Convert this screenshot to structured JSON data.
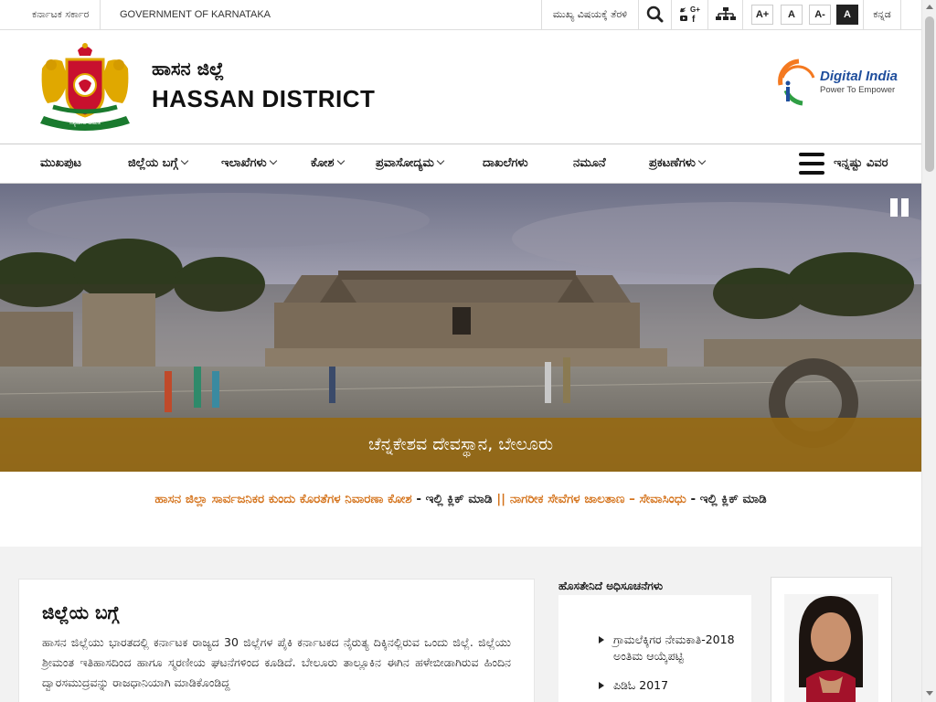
{
  "topbar": {
    "gov_kn": "ಕರ್ನಾಟಕ ಸರ್ಕಾರ",
    "gov_en": "GOVERNMENT OF KARNATAKA",
    "skip": "ಮುಖ್ಯ ವಿಷಯಕ್ಕೆ ತೆರಳಿ",
    "font_sizes": [
      "A+",
      "A",
      "A-",
      "A"
    ],
    "language": "ಕನ್ನಡ",
    "icons": [
      "search-icon",
      "social-icons",
      "sitemap-icon"
    ]
  },
  "header": {
    "title_kn": "ಹಾಸನ ಜಿಲ್ಲೆ",
    "title_en": "HASSAN DISTRICT",
    "emblem_text": "ಸತ್ಯಮೇವ ಜಯತೆ",
    "digital_india": {
      "title": "Digital India",
      "tagline": "Power To Empower"
    }
  },
  "nav": {
    "items": [
      {
        "label": "ಮುಖಪುಟ"
      },
      {
        "label": "ಜಿಲ್ಲೆಯ ಬಗ್ಗೆ"
      },
      {
        "label": "ಇಲಾಖೆಗಳು"
      },
      {
        "label": "ಕೋಶ"
      },
      {
        "label": "ಪ್ರವಾಸೋದ್ಯಮ"
      },
      {
        "label": "ದಾಖಲೆಗಳು"
      },
      {
        "label": "ನಮೂನೆ"
      },
      {
        "label": "ಪ್ರಕಟಣೆಗಳು"
      }
    ],
    "more": "ಇನ್ನಷ್ಟು ವಿವರ"
  },
  "hero": {
    "caption": "ಚೆನ್ನಕೇಶವ ದೇವಸ್ಥಾನ, ಬೇಲೂರು"
  },
  "infoline": {
    "link1": "ಹಾಸನ ಜಿಲ್ಲಾ ಸಾರ್ವಜನಿಕರ ಕುಂದು ಕೊರತೆಗಳ ನಿವಾರಣಾ ಕೋಶ",
    "click1": " - ಇಲ್ಲಿ ಕ್ಲಿಕ್ ಮಾಡಿ ",
    "sep": "||",
    "link2": " ನಾಗರೀಕ ಸೇವೆಗಳ ಜಾಲತಾಣ – ಸೇವಾಸಿಂಧು",
    "click2": " - ಇಲ್ಲಿ ಕ್ಲಿಕ್ ಮಾಡಿ"
  },
  "about": {
    "heading": "ಜಿಲ್ಲೆಯ ಬಗ್ಗೆ",
    "text": "ಹಾಸನ ಜಿಲ್ಲೆಯು ಭಾರತದಲ್ಲಿ ಕರ್ನಾಟಕ ರಾಜ್ಯದ 30 ಜಿಲ್ಲೆಗಳ ಪೈಕಿ ಕರ್ನಾಟಕದ ನೈರುತ್ಯ ದಿಕ್ಕಿನಲ್ಲಿರುವ ಒಂದು ಜಿಲ್ಲೆ. ಜಿಲ್ಲೆಯು ಶ್ರೀಮಂತ ಇತಿಹಾಸದಿಂದ ಹಾಗೂ ಸ್ಮರಣೀಯ ಘಟನೆಗಳಿಂದ ಕೂಡಿದೆ. ಬೇಲೂರು ತಾಲ್ಲೂಕಿನ ಈಗಿನ ಹಳೇಬೀಡಾಗಿರುವ ಹಿಂದಿನ ದ್ವಾರಸಮುದ್ರವನ್ನು ರಾಜಧಾನಿಯಾಗಿ ಮಾಡಿಕೊಂಡಿದ್ದ"
  },
  "notifications": {
    "title": "ಹೊಸತೇನಿದೆ ಅಧಿಸೂಚನೆಗಳು",
    "items": [
      {
        "text": "ಗ್ರಾಮಲೆಕ್ಕಿಗರ ನೇಮಕಾತಿ-2018 ಅಂತಿಮ ಆಯ್ಕೆಪಟ್ಟಿ"
      },
      {
        "text": "ಪಿಡಿಓ 2017"
      }
    ]
  }
}
